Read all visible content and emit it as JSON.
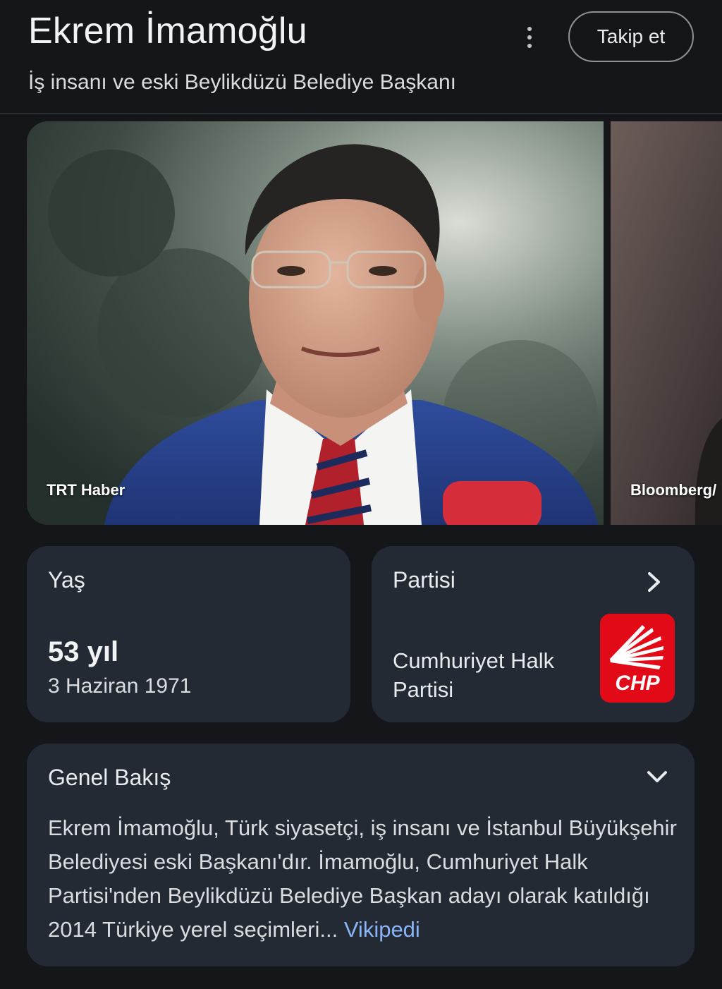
{
  "header": {
    "title": "Ekrem İmamoğlu",
    "subtitle": "İş insanı ve eski Beylikdüzü Belediye Başkanı",
    "follow_label": "Takip et"
  },
  "images": [
    {
      "source": "TRT Haber"
    },
    {
      "source": "Bloomberg/"
    }
  ],
  "age_card": {
    "label": "Yaş",
    "value": "53 yıl",
    "birth_date": "3 Haziran 1971"
  },
  "party_card": {
    "label": "Partisi",
    "name": "Cumhuriyet Halk Partisi",
    "logo_text": "CHP"
  },
  "overview": {
    "label": "Genel Bakış",
    "text": "Ekrem İmamoğlu, Türk siyasetçi, iş insanı ve İstanbul Büyükşehir Belediyesi eski Başkanı'dır. İmamoğlu, Cumhuriyet Halk Partisi'nden Beylikdüzü Belediye Başkan adayı olarak katıldığı 2014 Türkiye yerel seçimleri... ",
    "source_link": "Vikipedi"
  },
  "colors": {
    "background": "#14161a",
    "card": "#232a33",
    "link": "#8ab4f8",
    "chp_red": "#e30a17"
  }
}
